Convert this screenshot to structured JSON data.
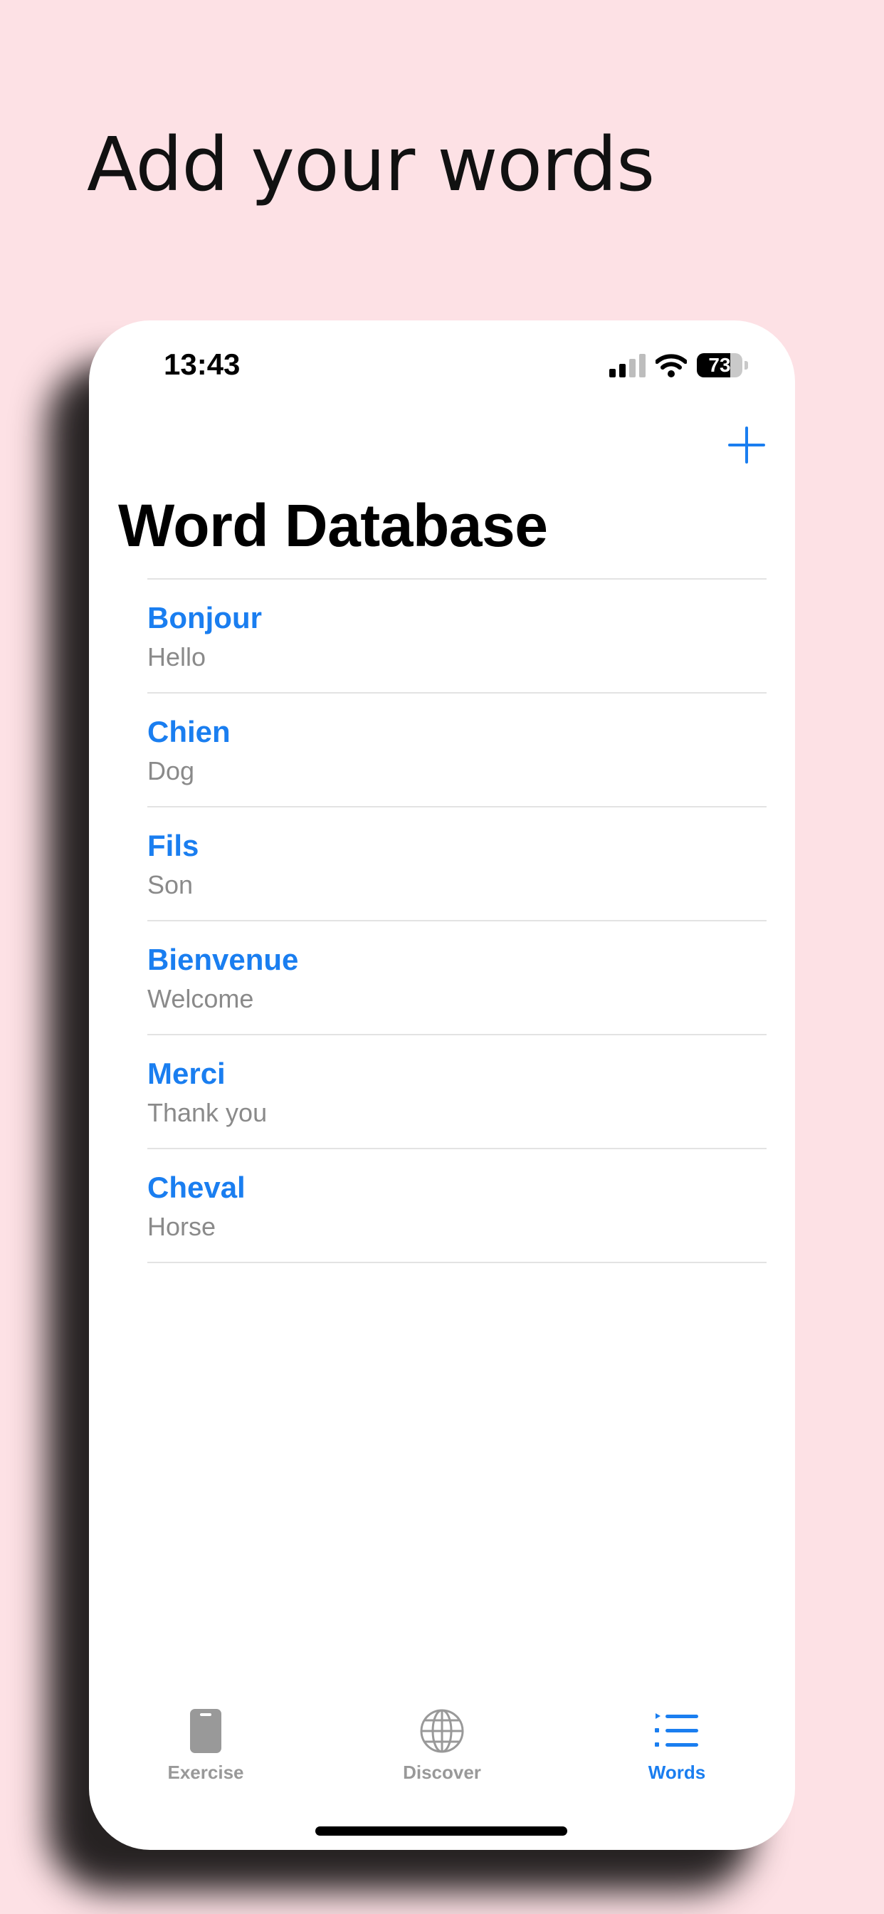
{
  "headline": "Add your words",
  "status_bar": {
    "time": "13:43",
    "battery": "73"
  },
  "nav": {
    "title": "Word Database",
    "add_icon": "plus-icon"
  },
  "words": [
    {
      "word": "Bonjour",
      "meaning": "Hello"
    },
    {
      "word": "Chien",
      "meaning": "Dog"
    },
    {
      "word": "Fils",
      "meaning": "Son"
    },
    {
      "word": "Bienvenue",
      "meaning": "Welcome"
    },
    {
      "word": "Merci",
      "meaning": "Thank you"
    },
    {
      "word": "Cheval",
      "meaning": "Horse"
    }
  ],
  "tabs": [
    {
      "label": "Exercise",
      "icon": "card-icon",
      "active": false
    },
    {
      "label": "Discover",
      "icon": "globe-icon",
      "active": false
    },
    {
      "label": "Words",
      "icon": "list-icon",
      "active": true
    }
  ],
  "colors": {
    "accent": "#1a7ef0",
    "background": "#fde1e5",
    "secondary_text": "#8a8a8a"
  }
}
